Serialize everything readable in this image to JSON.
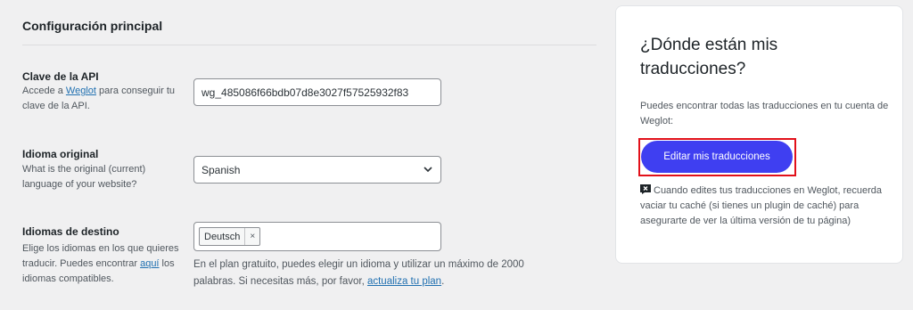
{
  "settings": {
    "title": "Configuración principal",
    "api_key": {
      "label": "Clave de la API",
      "desc_prefix": "Accede a ",
      "desc_link": "Weglot",
      "desc_suffix": " para conseguir tu clave de la API.",
      "value": "wg_485086f66bdb07d8e3027f57525932f83"
    },
    "original_language": {
      "label": "Idioma original",
      "desc": "What is the original (current) language of your website?",
      "value": "Spanish"
    },
    "destination_languages": {
      "label": "Idiomas de destino",
      "desc_prefix": "Elige los idiomas en los que quieres traducir. Puedes encontrar ",
      "desc_link": "aquí",
      "desc_suffix": " los idiomas compatibles.",
      "tags": [
        "Deutsch"
      ],
      "tag_remove": "×",
      "note_text": "En el plan gratuito, puedes elegir un idioma y utilizar un máximo de 2000 palabras. Si necesitas más, por favor, ",
      "note_link": "actualiza tu plan",
      "note_end": "."
    }
  },
  "sidebar": {
    "title": "¿Dónde están mis traducciones?",
    "text": "Puedes encontrar todas las traducciones en tu cuenta de Weglot:",
    "button_label": "Editar mis traducciones",
    "tip_icon": "warning-flag-icon",
    "tip": "Cuando edites tus traducciones en Weglot, recuerda vaciar tu caché (si tienes un plugin de caché) para asegurarte de ver la última versión de tu página)"
  },
  "colors": {
    "button": "#3f3ff1",
    "highlight_border": "#e2101a",
    "link": "#2271b1",
    "background": "#f0f0f1"
  }
}
